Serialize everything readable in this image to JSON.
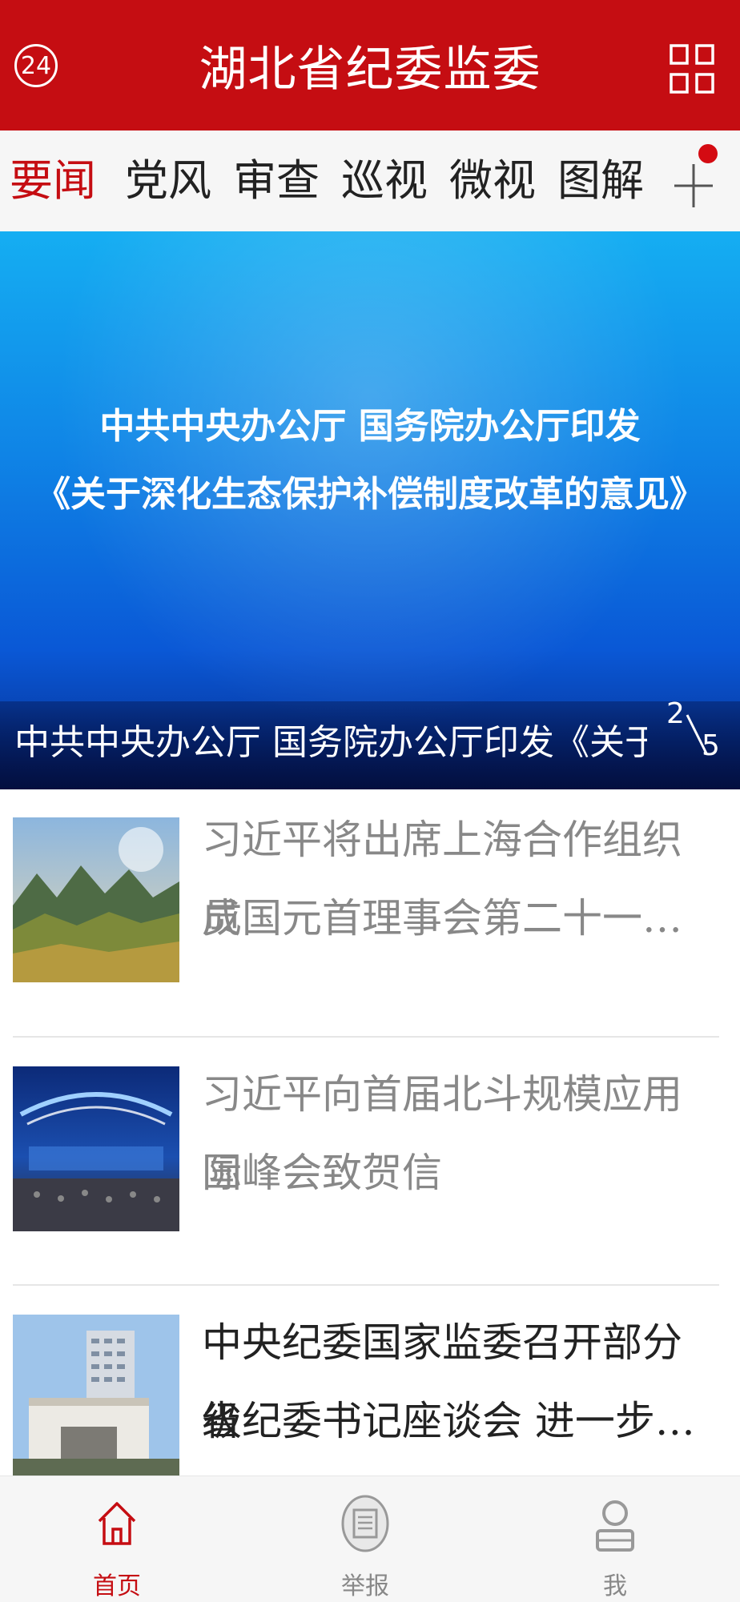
{
  "header": {
    "badge": "24",
    "title": "湖北省纪委监委"
  },
  "tabs": [
    {
      "label": "要闻",
      "active": true
    },
    {
      "label": "党风",
      "active": false
    },
    {
      "label": "审查",
      "active": false
    },
    {
      "label": "巡视",
      "active": false
    },
    {
      "label": "微视",
      "active": false
    },
    {
      "label": "图解",
      "active": false
    }
  ],
  "banner": {
    "line1": "中共中央办公厅 国务院办公厅印发",
    "line2": "《关于深化生态保护补偿制度改革的意见》",
    "caption": "中共中央办公厅 国务院办公厅印发《关于…",
    "page_current": "2",
    "page_total": "5"
  },
  "news": [
    {
      "title_line1": "习近平将出席上海合作组织成",
      "title_line2": "员国元首理事会第二十一…",
      "read": true,
      "thumb": "mountain-landscape"
    },
    {
      "title_line1": "习近平向首届北斗规模应用国",
      "title_line2": "际峰会致贺信",
      "read": true,
      "thumb": "beidou-summit-hall"
    },
    {
      "title_line1": "中央纪委国家监委召开部分省",
      "title_line2": "级纪委书记座谈会 进一步…",
      "read": false,
      "thumb": "government-building"
    }
  ],
  "bottom_nav": [
    {
      "label": "首页",
      "icon": "home-icon",
      "active": true
    },
    {
      "label": "举报",
      "icon": "report-icon",
      "active": false
    },
    {
      "label": "我",
      "icon": "person-icon",
      "active": false
    }
  ],
  "colors": {
    "brand_red": "#c50d12",
    "read_text": "#888888",
    "unread_text": "#222222"
  }
}
